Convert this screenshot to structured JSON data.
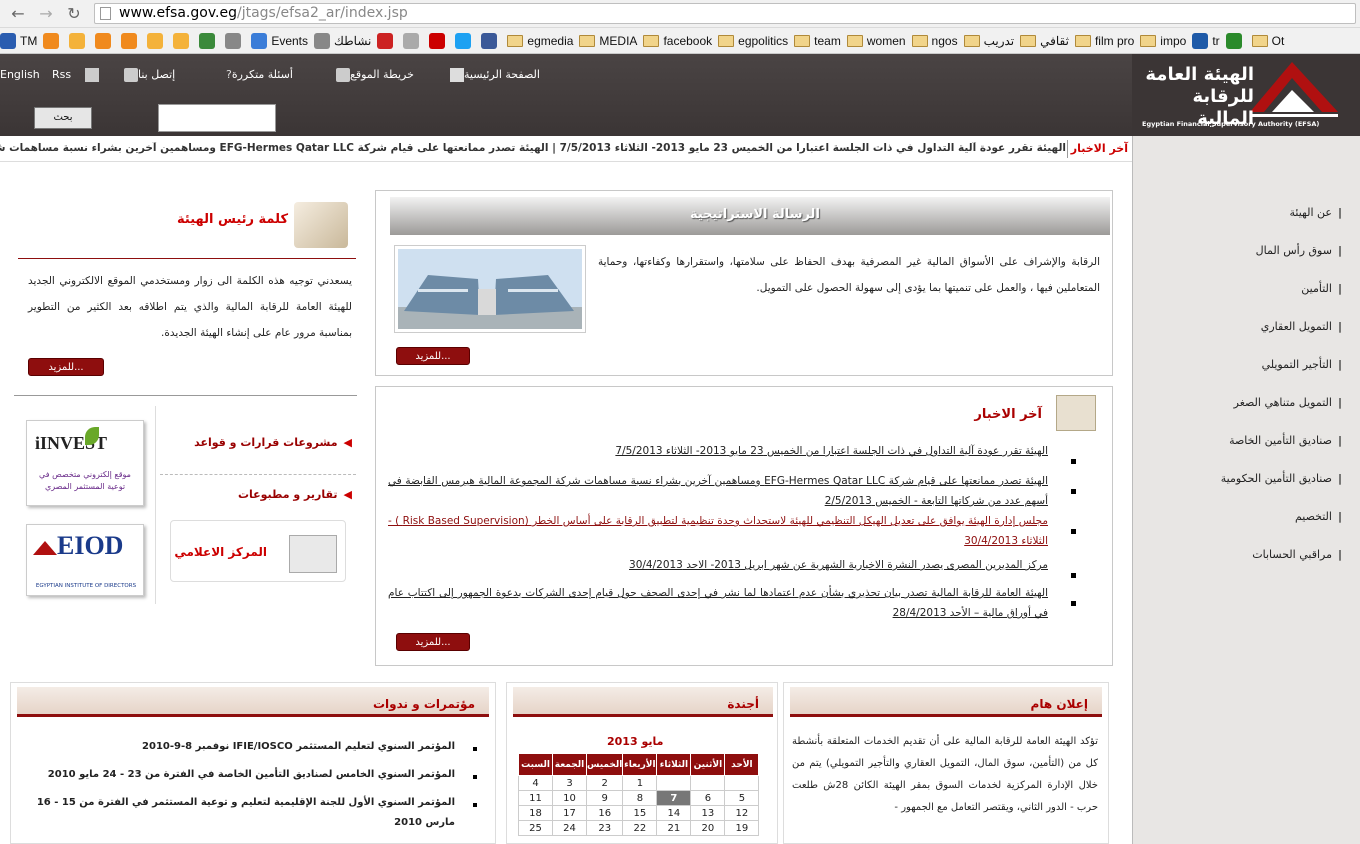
{
  "browser": {
    "url_host": "www.efsa.gov.eg",
    "url_path": "/jtags/efsa2_ar/index.jsp",
    "bookmarks": [
      "TM",
      "",
      "",
      "",
      "",
      "",
      "",
      "",
      "",
      "Events",
      "نشاطك",
      "",
      "",
      "",
      "",
      "",
      "egmedia",
      "MEDIA",
      "facebook",
      "egpolitics",
      "team",
      "women",
      "ngos",
      "تدريب",
      "ثقافي",
      "film pro",
      "impo",
      "tr",
      "",
      "Ot"
    ]
  },
  "header": {
    "home": "الصفحة الرئيسية",
    "sitemap": "خريطة الموقع",
    "faq": "أسئلة متكررة",
    "contact": "إتصل بنا",
    "rss": "Rss",
    "english": "English",
    "search_button": "بحث",
    "logo_ar": "الهيئة العامة للرقابة المالية",
    "logo_en": "Egyptian Financial Supervisory Authority (EFSA)"
  },
  "ticker": {
    "label": "آخر الاخبار",
    "text": "الهيئة تقرر عودة آلية التداول في ذات الجلسة اعتبارا من الخميس 23 مايو 2013- الثلاثاء 7/5/2013 | الهيئة تصدر ممانعتها على قيام شركة EFG-Hermes Qatar LLC ومساهمين آخرين بشراء نسبة مساهمات شركة المجموعة المالية هيرمس"
  },
  "sidebar": {
    "items": [
      "عن الهيئة",
      "سوق رأس المال",
      "التأمين",
      "التمويل العقاري",
      "التأجير التمويلي",
      "التمويل متناهي الصغر",
      "صناديق التأمين الخاصة",
      "صناديق التأمين الحكومية",
      "التخصيم",
      "مراقبي الحسابات"
    ]
  },
  "strategy": {
    "title": "الرسالة الاستراتيجية",
    "text": "الرقابة والإشراف على الأسواق المالية غير المصرفية بهدف الحفاظ على سلامتها، واستقرارها وكفاءتها، وحماية المتعاملين فيها ، والعمل على تنميتها بما يؤدى إلى سهولة الحصول على التمويل.",
    "more": "للمزيد..."
  },
  "chairman": {
    "title": "كلمة رئيس الهيئة",
    "text": "يسعدني توجيه هذه الكلمة الى زوار ومستخدمي الموقع الالكتروني الجديد للهيئة العامة للرقابة المالية والذي يتم اطلاقه بعد الكثير من التطوير بمناسبة مرور عام على إنشاء الهيئة الجديدة.",
    "more": "للمزيد..."
  },
  "links": {
    "drafts": "مشروعات قرارات و قواعد",
    "reports": "تقارير و مطبوعات",
    "media_center": "المركز الاعلامي",
    "invest_title": "iINVEST",
    "invest_sub": "موقع إلكتروني متخصص في توعية المستثمر المصري",
    "eiod_title": "EIOD",
    "eiod_sub": "EGYPTIAN INSTITUTE OF DIRECTORS"
  },
  "news": {
    "title": "آخر الاخبار",
    "items": [
      "الهيئة تقرر عودة آلية التداول في ذات الجلسة اعتبارا من الخميس 23 مايو 2013- الثلاثاء 7/5/2013",
      "الهيئة تصدر ممانعتها على قيام شركة EFG-Hermes Qatar LLC ومساهمين آخرين بشراء نسبة مساهمات شركة المجموعة المالية هيرمس القابضة في أسهم عدد من شركاتها التابعة - الخميس 2/5/2013",
      "مجلس إدارة الهيئة يوافق على تعديل الهيكل التنظيمي للهيئة لاستحداث وحدة تنظيمية لتطبيق الرقابة على أساس الخطر (Risk Based Supervision ) - الثلاثاء 30/4/2013",
      "مركز المديرين المصرى يصدر النشرة الاخبارية الشهرية عن شهر ابريل 2013- الاحد 30/4/2013",
      "الهيئة العامة للرقابة المالية تصدر بيان تحذيري بشأن عدم اعتمادها لما نشر في إحدى الصحف حول قيام إحدى الشركات بدعوة الجمهور إلى اكتتاب عام في أوراق مالية – الأحد 28/4/2013"
    ],
    "more": "للمزيد..."
  },
  "conferences": {
    "title": "مؤتمرات و ندوات",
    "items": [
      "المؤتمر السنوي لتعليم المستثمر IFIE/IOSCO نوفمبر 8-9-2010",
      "المؤتمر السنوي الخامس لصناديق التأمين الخاصة في الفترة من 23 - 24 مايو 2010",
      "المؤتمر السنوي الأول للجنة الإقليمية لتعليم و توعية المستثمر في الفترة من 15 - 16 مارس 2010"
    ]
  },
  "agenda": {
    "title": "أجندة",
    "month": "مايو 2013",
    "days": [
      "الأحد",
      "الأثنين",
      "الثلاثاء",
      "الأربعاء",
      "الخميس",
      "الجمعة",
      "السبت"
    ],
    "weeks": [
      [
        "",
        "",
        "",
        "1",
        "2",
        "3",
        "4"
      ],
      [
        "5",
        "6",
        "7",
        "8",
        "9",
        "10",
        "11"
      ],
      [
        "12",
        "13",
        "14",
        "15",
        "16",
        "17",
        "18"
      ],
      [
        "19",
        "20",
        "21",
        "22",
        "23",
        "24",
        "25"
      ]
    ],
    "today": "7"
  },
  "announcement": {
    "title": "إعلان هام",
    "text": "تؤكد الهيئة العامة للرقابة المالية على أن تقديم الخدمات المتعلقة بأنشطة كل من (التأمين، سوق المال، التمويل العقاري والتأجير التمويلي) يتم من خلال الإدارة المركزية لخدمات السوق بمقر الهيئة الكائن 28ش طلعت حرب - الدور الثاني، ويقتصر التعامل مع الجمهور -"
  }
}
